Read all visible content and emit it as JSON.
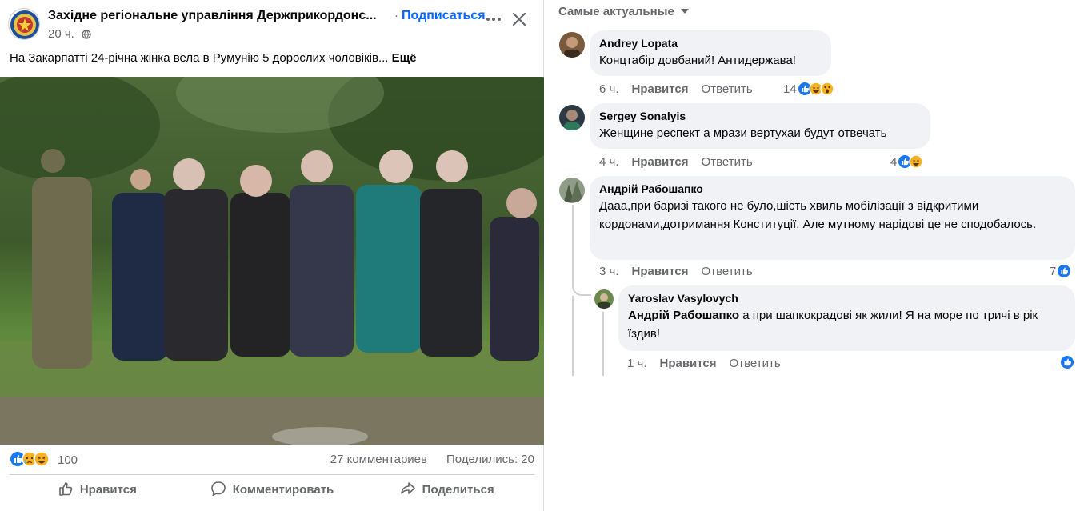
{
  "post": {
    "page_name": "Західне регіональне управління Держприкордонс...",
    "dot": "·",
    "subscribe": "Подписаться",
    "time": "20 ч.",
    "text": "На Закарпатті 24-річна жінка вела в Румунію 5 дорослих чоловіків...",
    "more_label": "Ещё",
    "reactions_count": "100",
    "comments_count": "27 комментариев",
    "shares_count": "Поделились: 20",
    "actions": {
      "like": "Нравится",
      "comment": "Комментировать",
      "share": "Поделиться"
    }
  },
  "comments_panel": {
    "sort_label": "Самые актуальные",
    "items": [
      {
        "author": "Andrey Lopata",
        "text": "Концтабір довбаний! Антидержава!",
        "time": "6 ч.",
        "like": "Нравится",
        "reply": "Ответить",
        "reactions": "14"
      },
      {
        "author": "Sergey Sonalyis",
        "text": "Женщине респект а мрази вертухаи будут отвечать",
        "time": "4 ч.",
        "like": "Нравится",
        "reply": "Ответить",
        "reactions": "4"
      },
      {
        "author": "Андрій Рабошапко",
        "text": "Дааа,при баризі такого не було,шість хвиль мобілізації з відкритими кордонами,дотримання Конституції. Але мутному нарідові це не сподобалось.",
        "time": "3 ч.",
        "like": "Нравится",
        "reply": "Ответить",
        "reactions": "7"
      },
      {
        "author": "Yaroslav Vasylovych",
        "mention": "Андрій Рабошапко",
        "text": " а при шапкокрадові як жили! Я на море по тричі в рік їздив!",
        "time": "1 ч.",
        "like": "Нравится",
        "reply": "Ответить",
        "reactions": ""
      }
    ]
  },
  "colors": {
    "accent": "#0866ff",
    "secondary_text": "#65676b",
    "bubble": "#f0f2f5",
    "like_blue": "#1877f2",
    "haha_yellow": "#f7b125"
  },
  "icons": [
    "globe-icon",
    "more-icon",
    "close-icon",
    "like-icon",
    "comment-icon",
    "share-icon",
    "like-reaction-icon",
    "haha-reaction-icon",
    "wow-reaction-icon",
    "sad-reaction-icon",
    "caret-down-icon"
  ]
}
